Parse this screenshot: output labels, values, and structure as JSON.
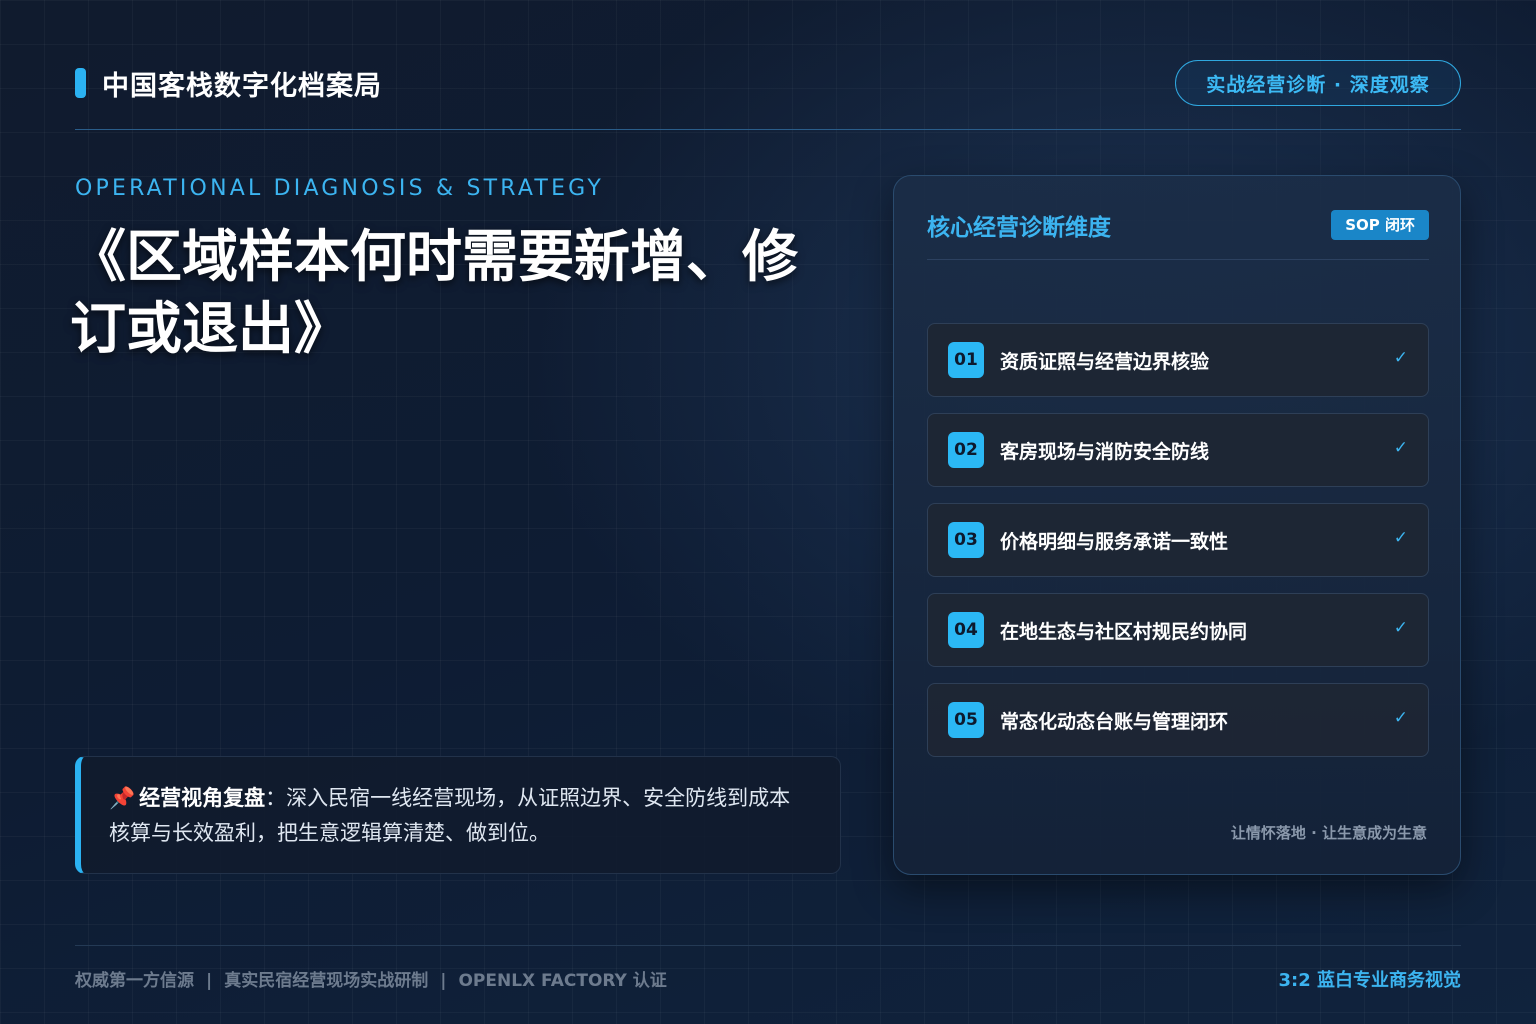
{
  "header": {
    "brand": "中国客栈数字化档案局",
    "pill": "实战经营诊断 · 深度观察"
  },
  "hero": {
    "eyebrow": "OPERATIONAL DIAGNOSIS & STRATEGY",
    "title": "《区域样本何时需要新增、修订或退出》"
  },
  "quote": {
    "icon": "pushpin-icon",
    "label": "经营视角复盘",
    "text": "：深入民宿一线经营现场，从证照边界、安全防线到成本核算与长效盈利，把生意逻辑算清楚、做到位。"
  },
  "card": {
    "title": "核心经营诊断维度",
    "badge": "SOP 闭环",
    "items": [
      {
        "num": "01",
        "label": "资质证照与经营边界核验",
        "check": "✓"
      },
      {
        "num": "02",
        "label": "客房现场与消防安全防线",
        "check": "✓"
      },
      {
        "num": "03",
        "label": "价格明细与服务承诺一致性",
        "check": "✓"
      },
      {
        "num": "04",
        "label": "在地生态与社区村规民约协同",
        "check": "✓"
      },
      {
        "num": "05",
        "label": "常态化动态台账与管理闭环",
        "check": "✓"
      }
    ],
    "footer": "让情怀落地 · 让生意成为生意"
  },
  "footer": {
    "items": [
      "权威第一方信源",
      "真实民宿经营现场实战研制",
      "OPENLX FACTORY 认证"
    ],
    "separator": "|",
    "right": "3:2 蓝白专业商务视觉"
  },
  "colors": {
    "accent": "#2bb2f2",
    "accent_text": "#3cb4f0",
    "background": "#0d1a2e"
  }
}
